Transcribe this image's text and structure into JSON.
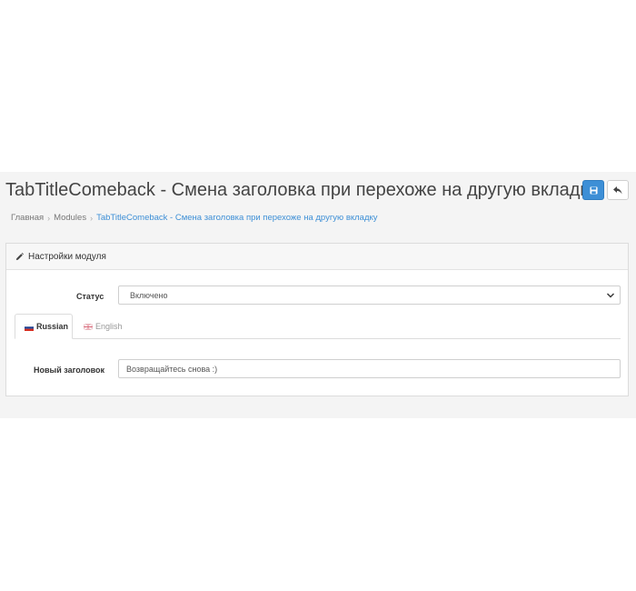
{
  "header": {
    "title": "TabTitleComeback - Смена заголовка при перехоже на другую вкладку",
    "save_icon": "save-icon",
    "back_icon": "reply-icon",
    "accent_color": "#3d8fd6"
  },
  "breadcrumb": {
    "items": [
      "Главная",
      "Modules",
      "TabTitleComeback - Смена заголовка при перехоже на другую вкладку"
    ]
  },
  "card": {
    "title": "Настройки модуля",
    "icon": "pencil-icon"
  },
  "form": {
    "status_label": "Статус",
    "status_value": "Включено",
    "tabs": [
      {
        "label": "Russian",
        "active": true,
        "flag": "russian-flag-icon"
      },
      {
        "label": "English",
        "active": false,
        "flag": "english-flag-icon"
      }
    ],
    "title_label": "Новый заголовок",
    "title_value": "Возвращайтесь снова :)"
  }
}
